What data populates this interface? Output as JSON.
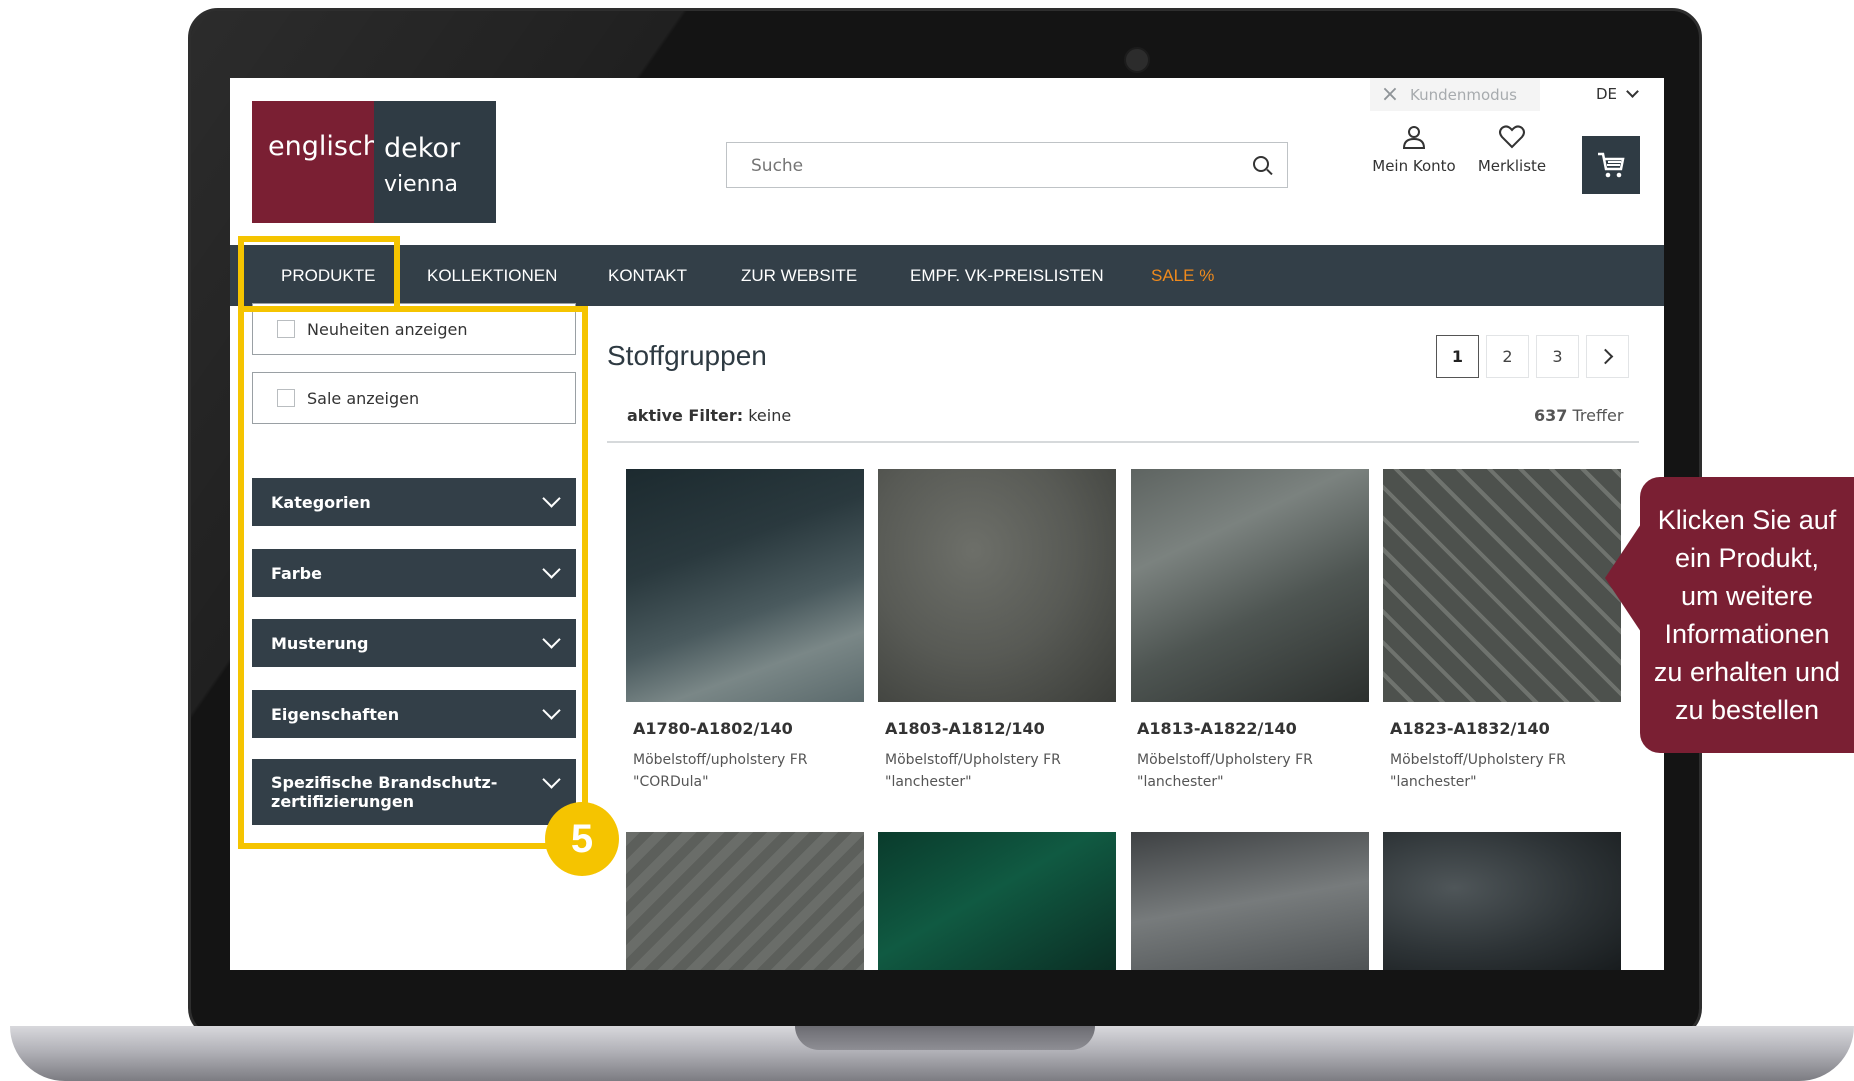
{
  "logo": {
    "left_word": "englisch",
    "right_word": "dekor",
    "sub_word": "vienna"
  },
  "search": {
    "placeholder": "Suche"
  },
  "header": {
    "kundenmodus": "Kundenmodus",
    "language": "DE",
    "account_label": "Mein Konto",
    "wishlist_label": "Merkliste"
  },
  "nav": {
    "items": [
      "PRODUKTE",
      "KOLLEKTIONEN",
      "KONTAKT",
      "ZUR WEBSITE",
      "EMPF. VK-PREISLISTEN",
      "SALE %"
    ],
    "sale_color": "#f08a1c"
  },
  "sidebar": {
    "checkboxes": [
      "Neuheiten anzeigen",
      "Sale anzeigen"
    ],
    "accordions": [
      "Kategorien",
      "Farbe",
      "Musterung",
      "Eigenschaften",
      "Spezifische Brandschutz-zertifizierungen"
    ]
  },
  "main": {
    "title": "Stoffgruppen",
    "pagination": [
      "1",
      "2",
      "3"
    ],
    "filter_label": "aktive Filter:",
    "filter_value": "keine",
    "result_count": "637",
    "result_label": "Treffer"
  },
  "products": [
    {
      "code": "A1780-A1802/140",
      "desc": "Möbelstoff/upholstery FR",
      "name": "\"CORDula\""
    },
    {
      "code": "A1803-A1812/140",
      "desc": "Möbelstoff/Upholstery FR",
      "name": "\"lanchester\""
    },
    {
      "code": "A1813-A1822/140",
      "desc": "Möbelstoff/Upholstery FR",
      "name": "\"lanchester\""
    },
    {
      "code": "A1823-A1832/140",
      "desc": "Möbelstoff/Upholstery FR",
      "name": "\"lanchester\""
    }
  ],
  "annotation": {
    "step": "5",
    "tooltip_lines": [
      "Klicken Sie auf",
      "ein Produkt,",
      "um weitere",
      "Informationen",
      "zu erhalten und",
      "zu bestellen"
    ],
    "highlight_color": "#f5c400",
    "tooltip_color": "#7a1f33"
  },
  "colors": {
    "brand_dark": "#333f48",
    "brand_red": "#7a1f33"
  }
}
